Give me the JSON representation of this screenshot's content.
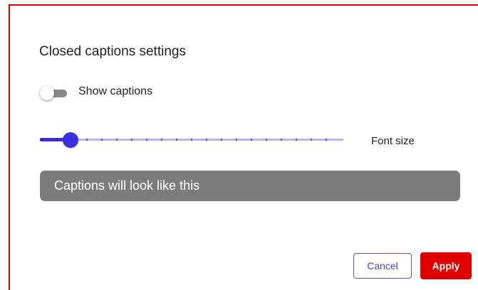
{
  "dialog": {
    "title": "Closed captions settings",
    "show_captions": {
      "label": "Show captions",
      "enabled": false
    },
    "font_size": {
      "label": "Font size",
      "steps": 20,
      "selected_step": 2
    },
    "preview": {
      "text": "Captions will look like this"
    },
    "buttons": {
      "cancel": "Cancel",
      "apply": "Apply"
    }
  },
  "colors": {
    "frame_border": "#e00000",
    "accent": "#3c2fe0",
    "accent_light": "#b9b4f5",
    "preview_background": "#7c7c7c",
    "apply_background": "#e00000",
    "toggle_track": "#888888"
  },
  "icons": {
    "toggle_thumb": "toggle-thumb",
    "slider_thumb": "slider-thumb"
  }
}
